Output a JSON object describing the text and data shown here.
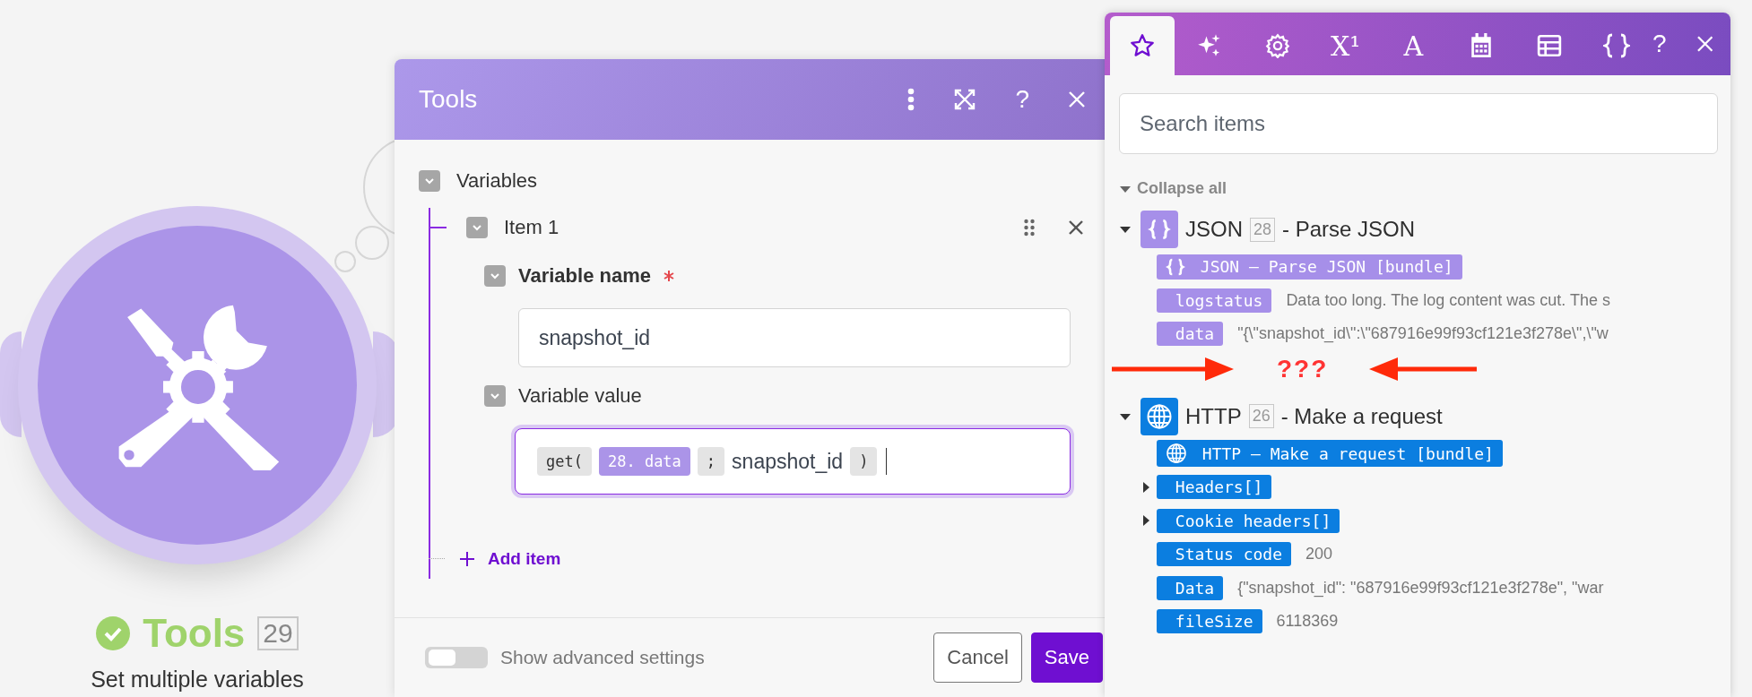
{
  "node": {
    "title": "Tools",
    "success": true,
    "number": "29",
    "subtitle": "Set multiple variables"
  },
  "dialog": {
    "title": "Tools",
    "help": "?",
    "section": {
      "label": "Variables",
      "expanded": true
    },
    "items": [
      {
        "label": "Item 1",
        "expanded": true,
        "fields": [
          {
            "kind": "text",
            "label": "Variable name",
            "required": true,
            "expanded": true,
            "value": "snapshot_id"
          },
          {
            "kind": "formula",
            "label": "Variable value",
            "required": false,
            "expanded": true,
            "focused": true,
            "tokens": [
              {
                "kind": "function",
                "text": "get("
              },
              {
                "kind": "variable",
                "text": "28. data"
              },
              {
                "kind": "separator",
                "text": ";"
              },
              {
                "kind": "plain",
                "text": "snapshot_id"
              },
              {
                "kind": "function",
                "text": ")"
              }
            ]
          }
        ]
      }
    ],
    "add_item": "Add item",
    "advanced_settings": {
      "label": "Show advanced settings",
      "on": false
    },
    "buttons": [
      {
        "kind": "secondary",
        "label": "Cancel"
      },
      {
        "kind": "primary",
        "label": "Save"
      }
    ]
  },
  "panel": {
    "tabs": [
      {
        "kind": "star",
        "selected": true
      },
      {
        "kind": "sparkles",
        "selected": false
      },
      {
        "kind": "gear",
        "selected": false
      },
      {
        "kind": "glyph",
        "text": "X¹",
        "selected": false
      },
      {
        "kind": "glyph",
        "text": "A",
        "selected": false
      },
      {
        "kind": "calendar",
        "selected": false
      },
      {
        "kind": "table",
        "selected": false
      },
      {
        "kind": "braces",
        "selected": false
      }
    ],
    "help": "?",
    "search": {
      "placeholder": "Search items"
    },
    "collapse_all": "Collapse all",
    "modules": [
      {
        "kind": "json",
        "color": "#a68fe9",
        "name": "JSON",
        "number": "28",
        "action": "- Parse JSON",
        "expanded": true,
        "items": [
          {
            "kind": "bundle",
            "label": "JSON – Parse JSON [bundle]"
          },
          {
            "kind": "field",
            "label": "logstatus",
            "value": "Data too long. The log content was cut. The s"
          },
          {
            "kind": "field",
            "label": "data",
            "value": "\"{\\\"snapshot_id\\\":\\\"687916e99f93cf121e3f278e\\\",\\\"w"
          }
        ]
      },
      {
        "kind": "http",
        "color": "#0b7ee0",
        "name": "HTTP",
        "number": "26",
        "action": "- Make a request",
        "expanded": true,
        "items": [
          {
            "kind": "bundle",
            "label": "HTTP – Make a request [bundle]"
          },
          {
            "kind": "collection",
            "label": "Headers[]",
            "expanded": false
          },
          {
            "kind": "collection",
            "label": "Cookie headers[]",
            "expanded": false
          },
          {
            "kind": "field",
            "label": "Status code",
            "value": "200"
          },
          {
            "kind": "field",
            "label": "Data",
            "value": "{\"snapshot_id\": \"687916e99f93cf121e3f278e\", \"war"
          },
          {
            "kind": "field",
            "label": "fileSize",
            "value": "6118369"
          }
        ]
      }
    ],
    "annotation": {
      "text": "???"
    }
  }
}
